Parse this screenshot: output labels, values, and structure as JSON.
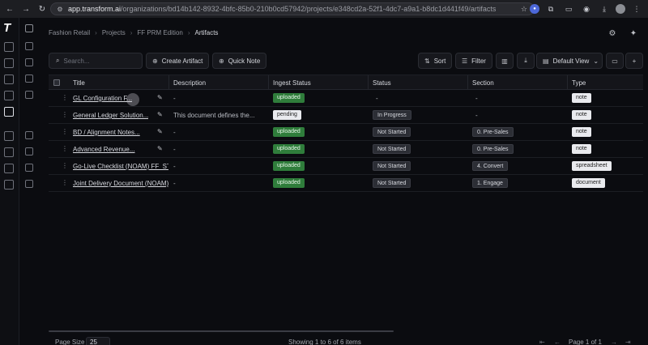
{
  "browser": {
    "url_host": "app.transform.ai",
    "url_path": "/organizations/bd14b142-8932-4bfc-85b0-210b0cd57942/projects/e348cd2a-52f1-4dc7-a9a1-b8dc1d441f49/artifacts"
  },
  "breadcrumb": [
    "Fashion Retail",
    "Projects",
    "FF PRM Edition",
    "Artifacts"
  ],
  "toolbar": {
    "search_placeholder": "Search...",
    "create_label": "Create Artifact",
    "note_label": "Quick Note",
    "sort_label": "Sort",
    "filter_label": "Filter",
    "view_label": "Default View"
  },
  "table": {
    "headers": [
      "Title",
      "Description",
      "Ingest Status",
      "Status",
      "Section",
      "Type"
    ],
    "rows": [
      {
        "title": "GL Configuration F...",
        "description": "-",
        "ingest": "uploaded",
        "status": "-",
        "section": "-",
        "type": "note"
      },
      {
        "title": "General Ledger Solution...",
        "description": "This document defines the...",
        "ingest": "pending",
        "status": "In Progress",
        "section": "-",
        "type": "note"
      },
      {
        "title": "BD / Alignment Notes...",
        "description": "-",
        "ingest": "uploaded",
        "status": "Not Started",
        "section": "0. Pre-Sales",
        "type": "note"
      },
      {
        "title": "Advanced Revenue...",
        "description": "-",
        "ingest": "uploaded",
        "status": "Not Started",
        "section": "0. Pre-Sales",
        "type": "note"
      },
      {
        "title": "Go-Live Checklist (NOAM) FF_ST...",
        "description": "-",
        "ingest": "uploaded",
        "status": "Not Started",
        "section": "4. Convert",
        "type": "spreadsheet"
      },
      {
        "title": "Joint Delivery Document (NOAM)",
        "description": "-",
        "ingest": "uploaded",
        "status": "Not Started",
        "section": "1. Engage",
        "type": "document"
      }
    ]
  },
  "footer": {
    "page_size_label": "Page Size",
    "page_size_value": "25",
    "showing": "Showing 1 to 6 of 6 items",
    "page": "Page 1 of 1"
  }
}
